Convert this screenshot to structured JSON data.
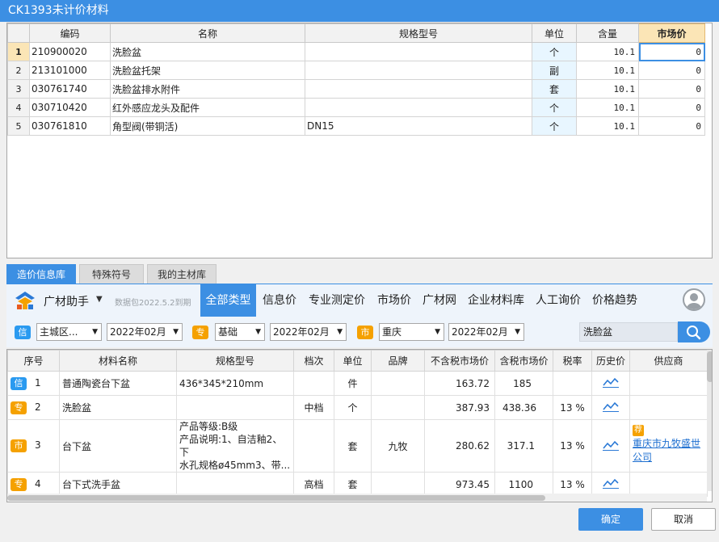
{
  "window": {
    "title": "CK1393未计价材料"
  },
  "top_table": {
    "columns": [
      "",
      "编码",
      "名称",
      "规格型号",
      "单位",
      "含量",
      "市场价"
    ],
    "rows": [
      {
        "no": "1",
        "code": "210900020",
        "name": "洗脸盆",
        "spec": "",
        "unit": "个",
        "qty": "10.1",
        "price": "0"
      },
      {
        "no": "2",
        "code": "213101000",
        "name": "洗脸盆托架",
        "spec": "",
        "unit": "副",
        "qty": "10.1",
        "price": "0"
      },
      {
        "no": "3",
        "code": "030761740",
        "name": "洗脸盆排水附件",
        "spec": "",
        "unit": "套",
        "qty": "10.1",
        "price": "0"
      },
      {
        "no": "4",
        "code": "030710420",
        "name": "红外感应龙头及配件",
        "spec": "",
        "unit": "个",
        "qty": "10.1",
        "price": "0"
      },
      {
        "no": "5",
        "code": "030761810",
        "name": "角型阀(带铜活)",
        "spec": "DN15",
        "unit": "个",
        "qty": "10.1",
        "price": "0"
      }
    ]
  },
  "tabs": [
    "造价信息库",
    "特殊符号",
    "我的主材库"
  ],
  "navbar": {
    "helper_label": "广材助手",
    "expire_text": "数据包2022.5.2到期",
    "tabs": [
      "全部类型",
      "信息价",
      "专业测定价",
      "市场价",
      "广材网",
      "企业材料库",
      "人工询价",
      "价格趋势"
    ]
  },
  "filters": {
    "badges": [
      "信",
      "专",
      "市"
    ],
    "selects": [
      "主城区...",
      "2022年02月",
      "基础",
      "2022年02月",
      "重庆",
      "2022年02月"
    ],
    "search_value": "洗脸盆"
  },
  "bottom_table": {
    "columns": [
      "序号",
      "材料名称",
      "规格型号",
      "档次",
      "单位",
      "品牌",
      "不含税市场价",
      "含税市场价",
      "税率",
      "历史价",
      "供应商"
    ],
    "rows": [
      {
        "badge": "信",
        "no": "1",
        "name": "普通陶瓷台下盆",
        "spec": [
          "436*345*210mm"
        ],
        "grade": "",
        "unit": "件",
        "brand": "",
        "price_ex": "163.72",
        "price_in": "185",
        "tax": "",
        "supplier_tag": "",
        "supplier": []
      },
      {
        "badge": "专",
        "no": "2",
        "name": "洗脸盆",
        "spec": [],
        "grade": "中档",
        "unit": "个",
        "brand": "",
        "price_ex": "387.93",
        "price_in": "438.36",
        "tax": "13 %",
        "supplier_tag": "",
        "supplier": []
      },
      {
        "badge": "市",
        "no": "3",
        "name": "台下盆",
        "spec": [
          "产品等级:B级",
          "产品说明:1、自洁釉2、下",
          "水孔规格ø45mm3、带..."
        ],
        "grade": "",
        "unit": "套",
        "brand": "九牧",
        "price_ex": "280.62",
        "price_in": "317.1",
        "tax": "13 %",
        "supplier_tag": "荐",
        "supplier": [
          "重庆市九牧盛世",
          "公司"
        ]
      },
      {
        "badge": "专",
        "no": "4",
        "name": "台下式洗手盆",
        "spec": [],
        "grade": "高档",
        "unit": "套",
        "brand": "",
        "price_ex": "973.45",
        "price_in": "1100",
        "tax": "13 %",
        "supplier_tag": "",
        "supplier": []
      }
    ]
  },
  "buttons": {
    "ok": "确定",
    "cancel": "取消"
  },
  "colors": {
    "accent": "#3c8fe3",
    "xin": "#2a9af0",
    "zhuan": "#f5a100",
    "shi": "#f5a100",
    "highlight_header": "#fbe5b6"
  }
}
